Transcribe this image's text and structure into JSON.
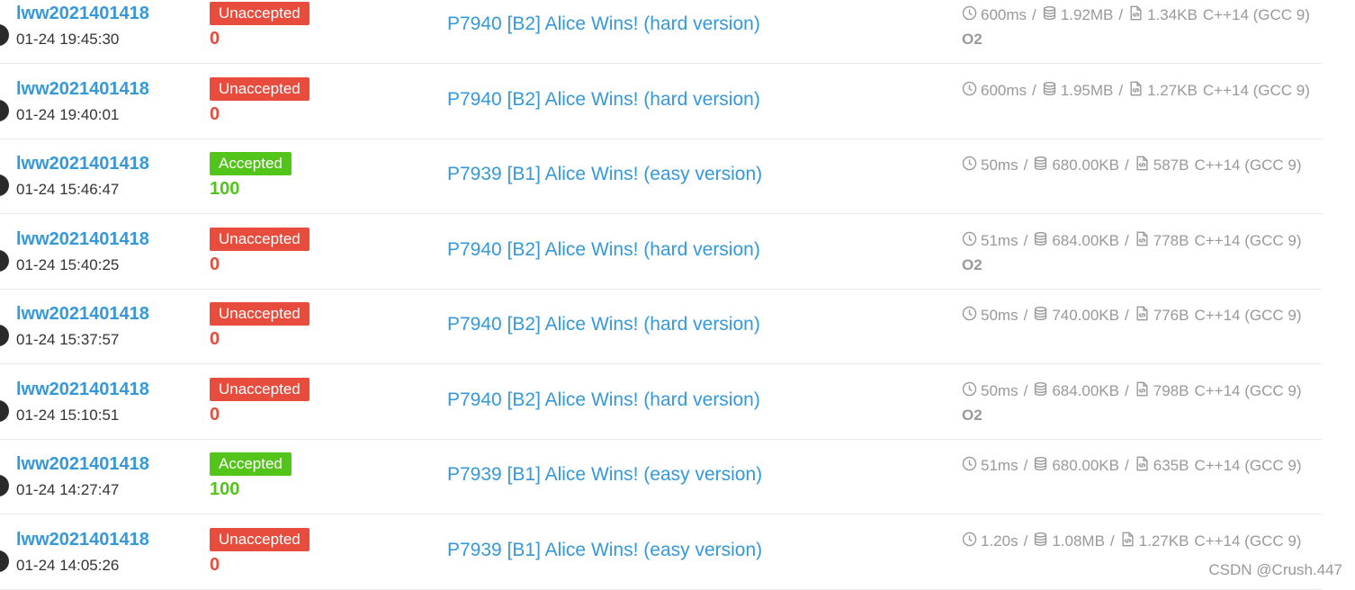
{
  "records": [
    {
      "user": "lww2021401418",
      "time": "01-24 19:45:30",
      "status": "Unaccepted",
      "status_kind": "wa",
      "score": "0",
      "problem": "P7940 [B2] Alice Wins! (hard version)",
      "runtime": "600ms",
      "memory": "1.92MB",
      "code_size": "1.34KB",
      "language": "C++14 (GCC 9)",
      "o2": "O2"
    },
    {
      "user": "lww2021401418",
      "time": "01-24 19:40:01",
      "status": "Unaccepted",
      "status_kind": "wa",
      "score": "0",
      "problem": "P7940 [B2] Alice Wins! (hard version)",
      "runtime": "600ms",
      "memory": "1.95MB",
      "code_size": "1.27KB",
      "language": "C++14 (GCC 9)",
      "o2": ""
    },
    {
      "user": "lww2021401418",
      "time": "01-24 15:46:47",
      "status": "Accepted",
      "status_kind": "ac",
      "score": "100",
      "problem": "P7939 [B1] Alice Wins! (easy version)",
      "runtime": "50ms",
      "memory": "680.00KB",
      "code_size": "587B",
      "language": "C++14 (GCC 9)",
      "o2": ""
    },
    {
      "user": "lww2021401418",
      "time": "01-24 15:40:25",
      "status": "Unaccepted",
      "status_kind": "wa",
      "score": "0",
      "problem": "P7940 [B2] Alice Wins! (hard version)",
      "runtime": "51ms",
      "memory": "684.00KB",
      "code_size": "778B",
      "language": "C++14 (GCC 9)",
      "o2": "O2"
    },
    {
      "user": "lww2021401418",
      "time": "01-24 15:37:57",
      "status": "Unaccepted",
      "status_kind": "wa",
      "score": "0",
      "problem": "P7940 [B2] Alice Wins! (hard version)",
      "runtime": "50ms",
      "memory": "740.00KB",
      "code_size": "776B",
      "language": "C++14 (GCC 9)",
      "o2": ""
    },
    {
      "user": "lww2021401418",
      "time": "01-24 15:10:51",
      "status": "Unaccepted",
      "status_kind": "wa",
      "score": "0",
      "problem": "P7940 [B2] Alice Wins! (hard version)",
      "runtime": "50ms",
      "memory": "684.00KB",
      "code_size": "798B",
      "language": "C++14 (GCC 9)",
      "o2": "O2"
    },
    {
      "user": "lww2021401418",
      "time": "01-24 14:27:47",
      "status": "Accepted",
      "status_kind": "ac",
      "score": "100",
      "problem": "P7939 [B1] Alice Wins! (easy version)",
      "runtime": "51ms",
      "memory": "680.00KB",
      "code_size": "635B",
      "language": "C++14 (GCC 9)",
      "o2": ""
    },
    {
      "user": "lww2021401418",
      "time": "01-24 14:05:26",
      "status": "Unaccepted",
      "status_kind": "wa",
      "score": "0",
      "problem": "P7939 [B1] Alice Wins! (easy version)",
      "runtime": "1.20s",
      "memory": "1.08MB",
      "code_size": "1.27KB",
      "language": "C++14 (GCC 9)",
      "o2": ""
    }
  ],
  "icons": {
    "runtime": "clock-icon",
    "memory": "database-icon",
    "code_size": "code-file-icon"
  },
  "colors": {
    "link": "#3498db",
    "unaccepted": "#e74c3c",
    "accepted": "#52c41a",
    "meta": "#999999"
  },
  "separator": "/",
  "watermark": "CSDN @Crush.447"
}
